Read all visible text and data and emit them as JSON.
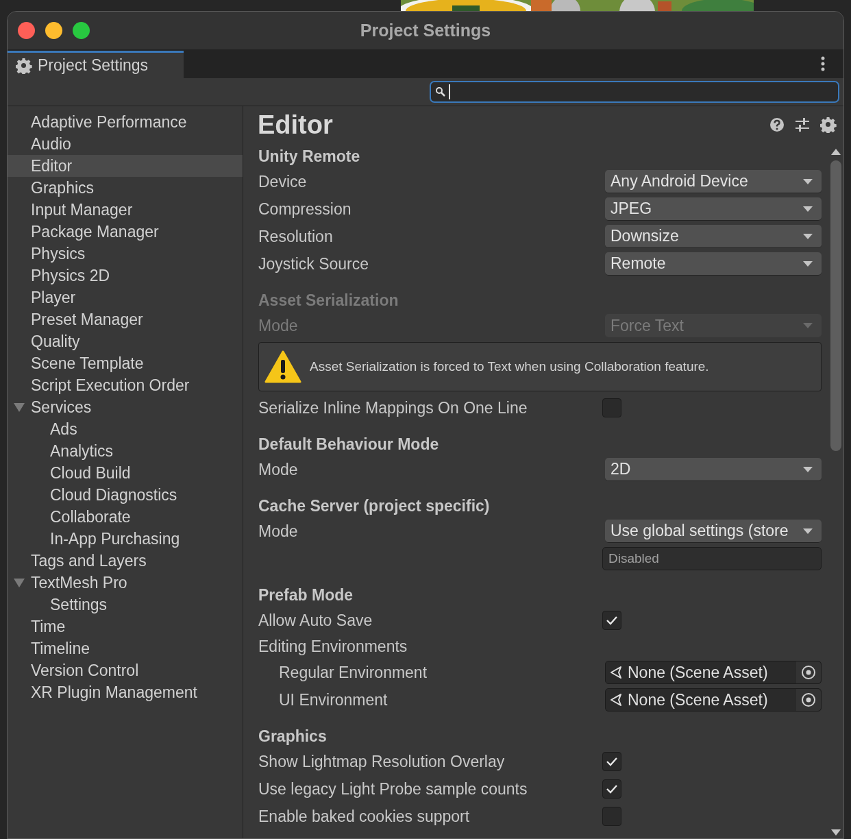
{
  "window": {
    "title": "Project Settings"
  },
  "tab": {
    "label": "Project Settings",
    "selected": true
  },
  "sidebar": {
    "items": [
      {
        "label": "Adaptive Performance",
        "selected": false
      },
      {
        "label": "Audio",
        "selected": false
      },
      {
        "label": "Editor",
        "selected": true
      },
      {
        "label": "Graphics",
        "selected": false
      },
      {
        "label": "Input Manager",
        "selected": false
      },
      {
        "label": "Package Manager",
        "selected": false
      },
      {
        "label": "Physics",
        "selected": false
      },
      {
        "label": "Physics 2D",
        "selected": false
      },
      {
        "label": "Player",
        "selected": false
      },
      {
        "label": "Preset Manager",
        "selected": false
      },
      {
        "label": "Quality",
        "selected": false
      },
      {
        "label": "Scene Template",
        "selected": false
      },
      {
        "label": "Script Execution Order",
        "selected": false
      },
      {
        "label": "Services",
        "selected": false,
        "expanded": true,
        "children": [
          {
            "label": "Ads",
            "selected": false
          },
          {
            "label": "Analytics",
            "selected": false
          },
          {
            "label": "Cloud Build",
            "selected": false
          },
          {
            "label": "Cloud Diagnostics",
            "selected": false
          },
          {
            "label": "Collaborate",
            "selected": false
          },
          {
            "label": "In-App Purchasing",
            "selected": false
          }
        ]
      },
      {
        "label": "Tags and Layers",
        "selected": false
      },
      {
        "label": "TextMesh Pro",
        "selected": false,
        "expanded": true,
        "children": [
          {
            "label": "Settings",
            "selected": false
          }
        ]
      },
      {
        "label": "Time",
        "selected": false
      },
      {
        "label": "Timeline",
        "selected": false
      },
      {
        "label": "Version Control",
        "selected": false
      },
      {
        "label": "XR Plugin Management",
        "selected": false
      }
    ]
  },
  "content": {
    "title": "Editor",
    "sections": [
      {
        "heading": "Unity Remote",
        "disabled": false,
        "rows": [
          {
            "kind": "dropdown",
            "label": "Device",
            "value": "Any Android Device"
          },
          {
            "kind": "dropdown",
            "label": "Compression",
            "value": "JPEG"
          },
          {
            "kind": "dropdown",
            "label": "Resolution",
            "value": "Downsize"
          },
          {
            "kind": "dropdown",
            "label": "Joystick Source",
            "value": "Remote"
          }
        ]
      },
      {
        "heading": "Asset Serialization",
        "disabled": true,
        "rows": [
          {
            "kind": "dropdown",
            "label": "Mode",
            "value": "Force Text"
          },
          {
            "kind": "warning",
            "text": "Asset Serialization is forced to Text when using Collaboration feature."
          },
          {
            "kind": "checkbox",
            "label": "Serialize Inline Mappings On One Line",
            "checked": false,
            "disabled": false
          }
        ]
      },
      {
        "heading": "Default Behaviour Mode",
        "disabled": false,
        "rows": [
          {
            "kind": "dropdown",
            "label": "Mode",
            "value": "2D"
          }
        ]
      },
      {
        "heading": "Cache Server (project specific)",
        "disabled": false,
        "rows": [
          {
            "kind": "dropdown",
            "label": "Mode",
            "value": "Use global settings (store"
          },
          {
            "kind": "field",
            "value": "Disabled"
          }
        ]
      },
      {
        "heading": "Prefab Mode",
        "disabled": false,
        "rows": [
          {
            "kind": "checkbox",
            "label": "Allow Auto Save",
            "checked": true
          },
          {
            "kind": "label",
            "label": "Editing Environments"
          },
          {
            "kind": "object",
            "label": "Regular Environment",
            "value": "None (Scene Asset)"
          },
          {
            "kind": "object",
            "label": "UI Environment",
            "value": "None (Scene Asset)"
          }
        ]
      },
      {
        "heading": "Graphics",
        "disabled": false,
        "rows": [
          {
            "kind": "checkbox",
            "label": "Show Lightmap Resolution Overlay",
            "checked": true
          },
          {
            "kind": "checkbox",
            "label": "Use legacy Light Probe sample counts",
            "checked": true
          },
          {
            "kind": "checkbox",
            "label": "Enable baked cookies support",
            "checked": false
          }
        ]
      }
    ]
  }
}
